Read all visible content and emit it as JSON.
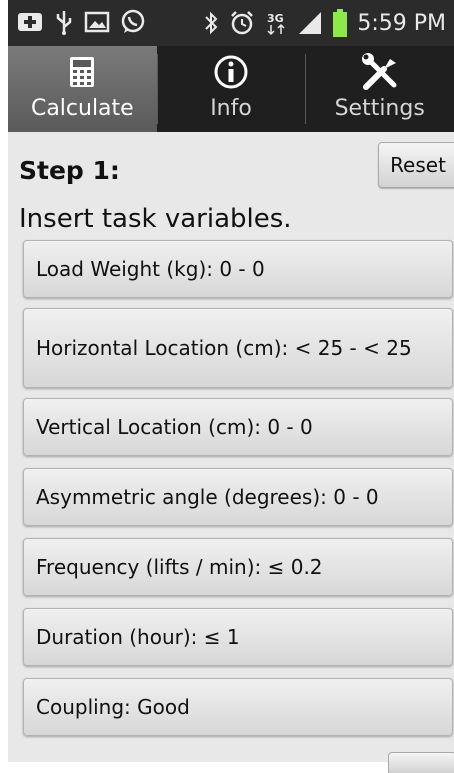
{
  "status_bar": {
    "time": "5:59 PM",
    "icons_left": [
      "plus-box-icon",
      "usb-icon",
      "picture-icon",
      "whatsapp-icon"
    ],
    "icons_right": [
      "bluetooth-icon",
      "alarm-icon",
      "3g-icon",
      "signal-icon",
      "battery-icon"
    ]
  },
  "tabs": [
    {
      "label": "Calculate",
      "icon": "calculator-icon",
      "active": true
    },
    {
      "label": "Info",
      "icon": "info-icon",
      "active": false
    },
    {
      "label": "Settings",
      "icon": "tools-icon",
      "active": false
    }
  ],
  "main": {
    "step_title": "Step 1:",
    "step_desc": "Insert task variables.",
    "reset_label": "Reset",
    "params": [
      {
        "label": "Load Weight (kg): 0 - 0"
      },
      {
        "label": "Horizontal Location (cm): < 25 - < 25"
      },
      {
        "label": "Vertical Location (cm): 0 - 0"
      },
      {
        "label": "Asymmetric angle (degrees): 0 - 0"
      },
      {
        "label": "Frequency (lifts / min): ≤ 0.2"
      },
      {
        "label": "Duration (hour): ≤ 1"
      },
      {
        "label": "Coupling: Good"
      }
    ]
  }
}
